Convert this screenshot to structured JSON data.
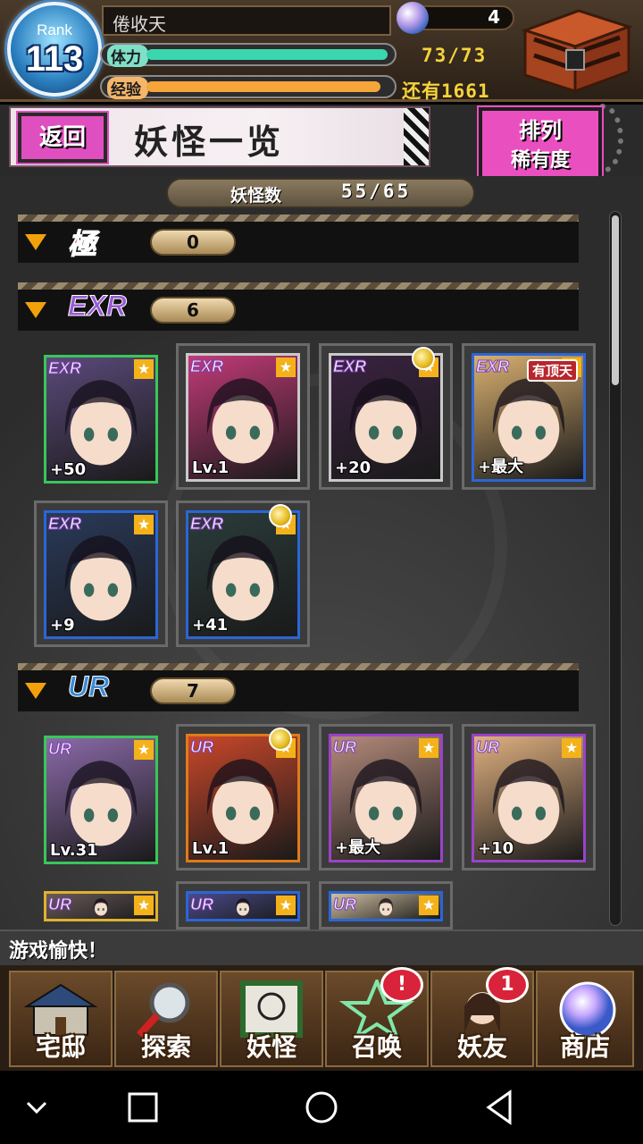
{
  "header": {
    "rank_label": "Rank",
    "rank_value": "113",
    "player_name": "倦收天",
    "gems": "4",
    "stamina_label": "体力",
    "stamina_value": "73/73",
    "stamina_fraction": 1.0,
    "exp_label": "经验",
    "exp_value": "还有1661",
    "exp_fraction": 0.97
  },
  "titlebar": {
    "back_label": "返回",
    "title": "妖怪一览",
    "sort_top": "排列",
    "sort_bottom": "稀有度"
  },
  "count": {
    "label": "妖怪数",
    "value": "55/65"
  },
  "sections": [
    {
      "rarity": "極",
      "count": "0"
    },
    {
      "rarity": "EXR",
      "count": "6"
    },
    {
      "rarity": "UR",
      "count": "7"
    }
  ],
  "exr_cards": [
    {
      "badge": "EXR",
      "value": "+50",
      "frame": "#39c65a",
      "bg": "#5a4a7a"
    },
    {
      "badge": "EXR",
      "value": "Lv.1",
      "frame": "#c9c9c9",
      "bg": "#c23a78"
    },
    {
      "badge": "EXR",
      "value": "+20",
      "frame": "#c9c9c9",
      "bg": "#3a2240"
    },
    {
      "badge": "EXR",
      "value": "+最大",
      "frame": "#2b66d6",
      "bg": "#d9b070",
      "tag": "有顶天"
    },
    {
      "badge": "EXR",
      "value": "+9",
      "frame": "#2b66d6",
      "bg": "#2a3a5a"
    },
    {
      "badge": "EXR",
      "value": "+41",
      "frame": "#2b66d6",
      "bg": "#2a3c3a"
    }
  ],
  "ur_cards": [
    {
      "badge": "UR",
      "value": "Lv.31",
      "frame": "#39c65a",
      "bg": "#8a6aa8"
    },
    {
      "badge": "UR",
      "value": "Lv.1",
      "frame": "#e07a1a",
      "bg": "#c9472a"
    },
    {
      "badge": "UR",
      "value": "+最大",
      "frame": "#9a43c7",
      "bg": "#b48a7a"
    },
    {
      "badge": "UR",
      "value": "+10",
      "frame": "#9a43c7",
      "bg": "#e0b080"
    },
    {
      "badge": "UR",
      "value": "",
      "frame": "#e0b030",
      "bg": "#6a5a5a"
    },
    {
      "badge": "UR",
      "value": "",
      "frame": "#2b66d6",
      "bg": "#4a4a8a"
    },
    {
      "badge": "UR",
      "value": "",
      "frame": "#2b66d6",
      "bg": "#d0c0a0"
    }
  ],
  "status_text": "游戏愉快！",
  "nav": [
    {
      "label": "宅邸",
      "icon": "house-icon"
    },
    {
      "label": "探索",
      "icon": "magnifier-icon"
    },
    {
      "label": "妖怪",
      "icon": "scroll-icon"
    },
    {
      "label": "召唤",
      "icon": "pentagram-icon",
      "badge": "!"
    },
    {
      "label": "妖友",
      "icon": "friend-icon",
      "badge": "1"
    },
    {
      "label": "商店",
      "icon": "orb-icon"
    }
  ],
  "colors": {
    "accent_pink": "#e04fbf",
    "gold": "#f5d33c",
    "stamina": "#3ad6b0",
    "exp": "#f5a53a"
  }
}
